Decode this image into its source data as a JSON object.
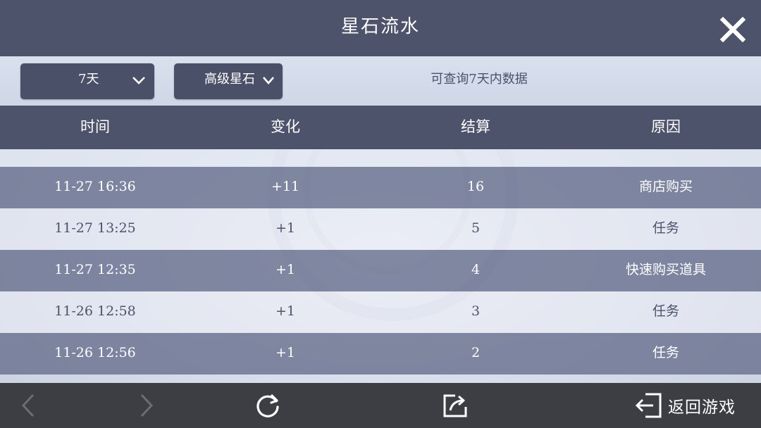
{
  "header": {
    "title": "星石流水",
    "close_icon": "close-icon"
  },
  "filters": {
    "days": {
      "selected": "7天"
    },
    "type": {
      "selected": "高级星石"
    },
    "hint": "可查询7天内数据"
  },
  "table": {
    "columns": [
      "时间",
      "变化",
      "结算",
      "原因"
    ],
    "rows": [
      [
        "11-27 16:36",
        "+11",
        "16",
        "商店购买"
      ],
      [
        "11-27 13:25",
        "+1",
        "5",
        "任务"
      ],
      [
        "11-27 12:35",
        "+1",
        "4",
        "快速购买道具"
      ],
      [
        "11-26 12:58",
        "+1",
        "3",
        "任务"
      ],
      [
        "11-26 12:56",
        "+1",
        "2",
        "任务"
      ]
    ]
  },
  "footer": {
    "back_icon": "chevron-left-icon",
    "forward_icon": "chevron-right-icon",
    "refresh_icon": "refresh-icon",
    "share_icon": "share-icon",
    "return_label": "返回游戏",
    "return_icon": "exit-icon"
  },
  "colors": {
    "header_bg": "#4e536c",
    "row_dark": "#646c8a",
    "row_light": "#eceff6",
    "footer_bg": "#3c3e44",
    "text_dark": "#4e536c"
  }
}
